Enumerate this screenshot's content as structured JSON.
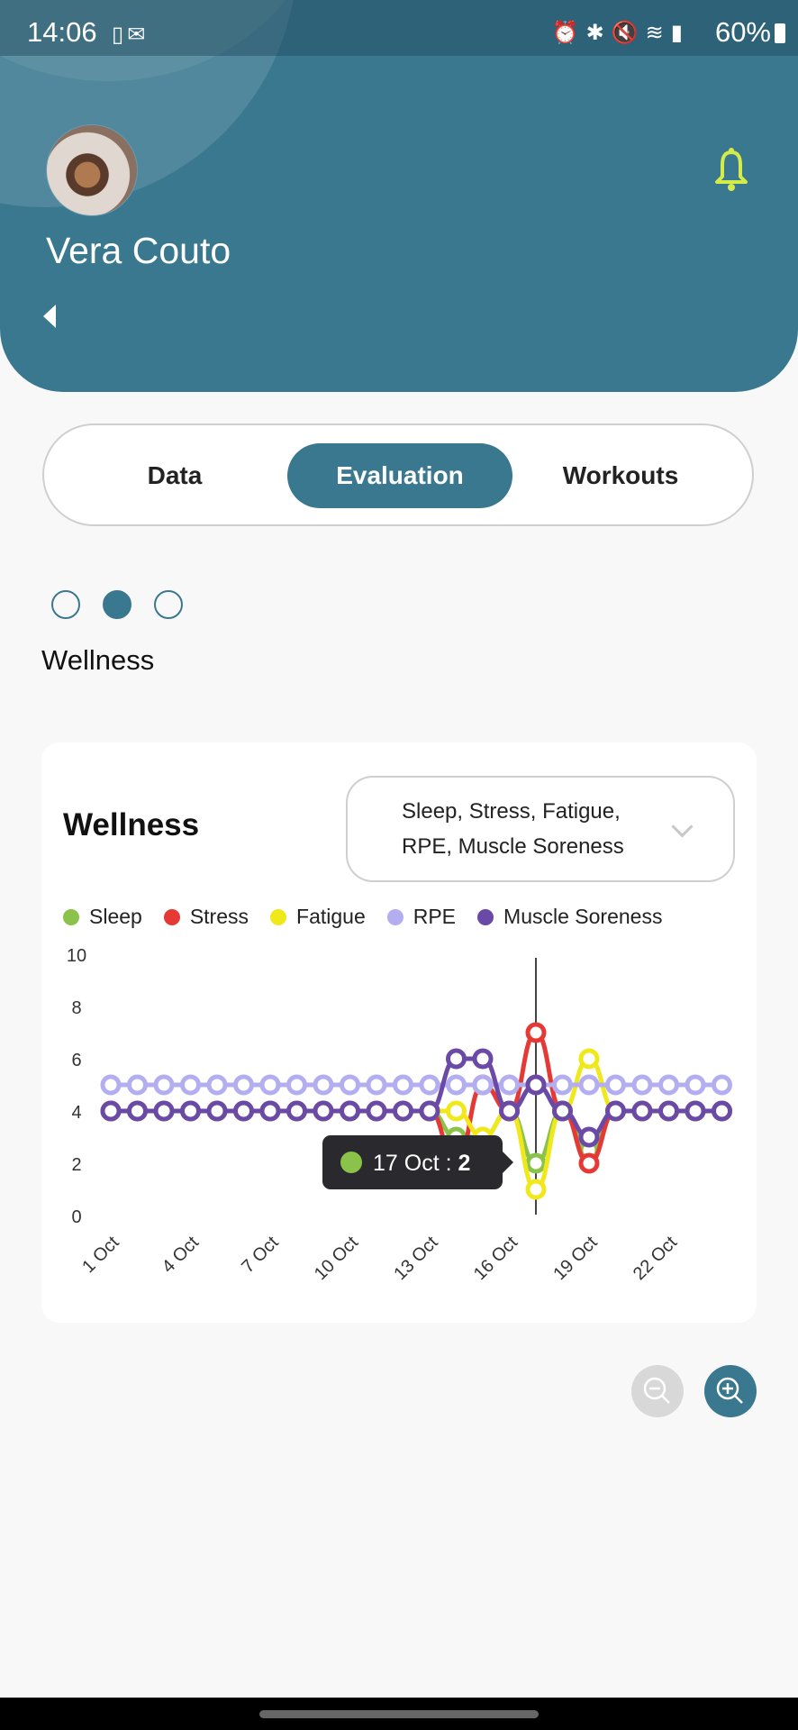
{
  "status_bar": {
    "time": "14:06",
    "left_icons": [
      "device-icon",
      "outlook-icon"
    ],
    "right_icons": [
      "alarm-icon",
      "bluetooth-icon",
      "mute-icon",
      "wifi-icon",
      "signal-icon"
    ],
    "battery": "60%"
  },
  "header": {
    "user_name": "Vera Couto",
    "back_icon": "back-arrow-icon",
    "notification_icon": "bell-icon",
    "colors": {
      "primary": "#3a7890",
      "bell": "#d4ec4a"
    }
  },
  "tabs": [
    {
      "label": "Data",
      "active": false
    },
    {
      "label": "Evaluation",
      "active": true
    },
    {
      "label": "Workouts",
      "active": false
    }
  ],
  "pager": {
    "count": 3,
    "active_index": 1
  },
  "section_label": "Wellness",
  "card": {
    "title": "Wellness",
    "select_value": "Sleep, Stress, Fatigue, RPE, Muscle Soreness"
  },
  "tooltip": {
    "color": "#8bc34a",
    "date": "17 Oct",
    "separator": " : ",
    "value": "2"
  },
  "zoom_controls": {
    "zoom_out": "zoom-out-icon",
    "zoom_in": "zoom-in-icon"
  },
  "chart_data": {
    "type": "line",
    "title": "Wellness",
    "xlabel": "",
    "ylabel": "",
    "ylim": [
      0,
      10
    ],
    "yticks": [
      "0",
      "2",
      "4",
      "6",
      "8",
      "10"
    ],
    "x": [
      "1 Oct",
      "2 Oct",
      "3 Oct",
      "4 Oct",
      "5 Oct",
      "6 Oct",
      "7 Oct",
      "8 Oct",
      "9 Oct",
      "10 Oct",
      "11 Oct",
      "12 Oct",
      "13 Oct",
      "14 Oct",
      "15 Oct",
      "16 Oct",
      "17 Oct",
      "18 Oct",
      "19 Oct",
      "20 Oct",
      "21 Oct",
      "22 Oct",
      "23 Oct",
      "24 Oct"
    ],
    "xtick_labels": [
      "1 Oct",
      "4 Oct",
      "7 Oct",
      "10 Oct",
      "13 Oct",
      "16 Oct",
      "19 Oct",
      "22 Oct"
    ],
    "crosshair_at": "17 Oct",
    "legend_position": "top-left",
    "series": [
      {
        "name": "Sleep",
        "color": "#8bc34a",
        "values": [
          4,
          4,
          4,
          4,
          4,
          4,
          4,
          4,
          4,
          4,
          4,
          4,
          4,
          3,
          3,
          4,
          2,
          4,
          2.5,
          4,
          4,
          4,
          4,
          4
        ]
      },
      {
        "name": "Stress",
        "color": "#e53935",
        "values": [
          4,
          4,
          4,
          4,
          4,
          4,
          4,
          4,
          4,
          4,
          4,
          4,
          4,
          2,
          5,
          4,
          7,
          4,
          2,
          4,
          4,
          4,
          4,
          4
        ]
      },
      {
        "name": "Fatigue",
        "color": "#f1e81c",
        "values": [
          4,
          4,
          4,
          4,
          4,
          4,
          4,
          4,
          4,
          4,
          4,
          4,
          4,
          4,
          3,
          4,
          1,
          4,
          6,
          4,
          4,
          4,
          4,
          4
        ]
      },
      {
        "name": "RPE",
        "color": "#b3aef0",
        "values": [
          5,
          5,
          5,
          5,
          5,
          5,
          5,
          5,
          5,
          5,
          5,
          5,
          5,
          5,
          5,
          5,
          5,
          5,
          5,
          5,
          5,
          5,
          5,
          5
        ]
      },
      {
        "name": "Muscle Soreness",
        "color": "#6a4aa6",
        "values": [
          4,
          4,
          4,
          4,
          4,
          4,
          4,
          4,
          4,
          4,
          4,
          4,
          4,
          6,
          6,
          4,
          5,
          4,
          3,
          4,
          4,
          4,
          4,
          4
        ]
      }
    ]
  }
}
